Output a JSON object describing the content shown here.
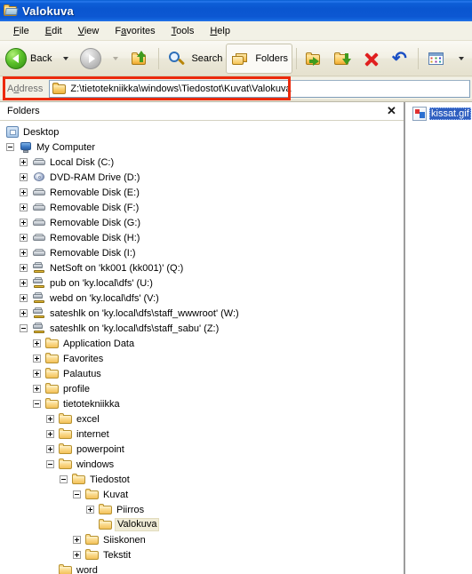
{
  "window": {
    "title": "Valokuva",
    "title_icon": "open-folder-icon"
  },
  "menubar": {
    "items": [
      {
        "label": "File",
        "accel": "F"
      },
      {
        "label": "Edit",
        "accel": "E"
      },
      {
        "label": "View",
        "accel": "V"
      },
      {
        "label": "Favorites",
        "accel": "a"
      },
      {
        "label": "Tools",
        "accel": "T"
      },
      {
        "label": "Help",
        "accel": "H"
      }
    ]
  },
  "toolbar": {
    "back_label": "Back",
    "search_label": "Search",
    "folders_label": "Folders",
    "buttons": [
      {
        "name": "back-button",
        "icon": "back-arrow-icon"
      },
      {
        "name": "back-dropdown",
        "icon": "chevron-down-icon"
      },
      {
        "name": "forward-button",
        "icon": "forward-arrow-icon"
      },
      {
        "name": "forward-dropdown",
        "icon": "chevron-down-icon"
      },
      {
        "name": "up-button",
        "icon": "up-folder-icon"
      },
      {
        "name": "search-button",
        "icon": "search-icon"
      },
      {
        "name": "folders-button",
        "icon": "folders-icon"
      },
      {
        "name": "move-to-button",
        "icon": "move-to-folder-icon"
      },
      {
        "name": "copy-to-button",
        "icon": "copy-to-folder-icon"
      },
      {
        "name": "delete-button",
        "icon": "delete-x-icon"
      },
      {
        "name": "undo-button",
        "icon": "undo-arrow-icon"
      },
      {
        "name": "views-button",
        "icon": "views-icon"
      },
      {
        "name": "views-dropdown",
        "icon": "chevron-down-icon"
      },
      {
        "name": "folder-sync-button",
        "icon": "folder-sync-icon"
      }
    ]
  },
  "address": {
    "label": "Address",
    "accel": "d",
    "path": "Z:\\tietotekniikka\\windows\\Tiedostot\\Kuvat\\Valokuva",
    "icon": "folder-icon",
    "highlight_color": "#ec2a0c"
  },
  "folders_pane": {
    "title": "Folders",
    "close_label": "✕"
  },
  "tree": [
    {
      "label": "Desktop",
      "depth": 0,
      "icon": "desktop-icon",
      "expander": "none",
      "selected": false
    },
    {
      "label": "My Computer",
      "depth": 1,
      "icon": "computer-icon",
      "expander": "minus",
      "selected": false
    },
    {
      "label": "Local Disk (C:)",
      "depth": 2,
      "icon": "drive-icon",
      "expander": "plus",
      "selected": false
    },
    {
      "label": "DVD-RAM Drive (D:)",
      "depth": 2,
      "icon": "dvd-drive-icon",
      "expander": "plus",
      "selected": false
    },
    {
      "label": "Removable Disk (E:)",
      "depth": 2,
      "icon": "drive-icon",
      "expander": "plus",
      "selected": false
    },
    {
      "label": "Removable Disk (F:)",
      "depth": 2,
      "icon": "drive-icon",
      "expander": "plus",
      "selected": false
    },
    {
      "label": "Removable Disk (G:)",
      "depth": 2,
      "icon": "drive-icon",
      "expander": "plus",
      "selected": false
    },
    {
      "label": "Removable Disk (H:)",
      "depth": 2,
      "icon": "drive-icon",
      "expander": "plus",
      "selected": false
    },
    {
      "label": "Removable Disk (I:)",
      "depth": 2,
      "icon": "drive-icon",
      "expander": "plus",
      "selected": false
    },
    {
      "label": "NetSoft on 'kk001 (kk001)' (Q:)",
      "depth": 2,
      "icon": "network-drive-icon",
      "expander": "plus",
      "selected": false
    },
    {
      "label": "pub on 'ky.local\\dfs' (U:)",
      "depth": 2,
      "icon": "network-drive-icon",
      "expander": "plus",
      "selected": false
    },
    {
      "label": "webd on 'ky.local\\dfs' (V:)",
      "depth": 2,
      "icon": "network-drive-icon",
      "expander": "plus",
      "selected": false
    },
    {
      "label": "sateshlk on 'ky.local\\dfs\\staff_wwwroot' (W:)",
      "depth": 2,
      "icon": "network-drive-icon",
      "expander": "plus",
      "selected": false
    },
    {
      "label": "sateshlk on 'ky.local\\dfs\\staff_sabu' (Z:)",
      "depth": 2,
      "icon": "network-drive-icon",
      "expander": "minus",
      "selected": false
    },
    {
      "label": "Application Data",
      "depth": 3,
      "icon": "folder-icon",
      "expander": "plus",
      "selected": false
    },
    {
      "label": "Favorites",
      "depth": 3,
      "icon": "folder-icon",
      "expander": "plus",
      "selected": false
    },
    {
      "label": "Palautus",
      "depth": 3,
      "icon": "folder-icon",
      "expander": "plus",
      "selected": false
    },
    {
      "label": "profile",
      "depth": 3,
      "icon": "folder-icon",
      "expander": "plus",
      "selected": false
    },
    {
      "label": "tietotekniikka",
      "depth": 3,
      "icon": "folder-icon",
      "expander": "minus",
      "selected": false
    },
    {
      "label": "excel",
      "depth": 4,
      "icon": "folder-icon",
      "expander": "plus",
      "selected": false
    },
    {
      "label": "internet",
      "depth": 4,
      "icon": "folder-icon",
      "expander": "plus",
      "selected": false
    },
    {
      "label": "powerpoint",
      "depth": 4,
      "icon": "folder-icon",
      "expander": "plus",
      "selected": false
    },
    {
      "label": "windows",
      "depth": 4,
      "icon": "folder-icon",
      "expander": "minus",
      "selected": false
    },
    {
      "label": "Tiedostot",
      "depth": 5,
      "icon": "folder-icon",
      "expander": "minus",
      "selected": false
    },
    {
      "label": "Kuvat",
      "depth": 6,
      "icon": "folder-icon",
      "expander": "minus",
      "selected": false
    },
    {
      "label": "Piirros",
      "depth": 7,
      "icon": "folder-icon",
      "expander": "plus",
      "selected": false
    },
    {
      "label": "Valokuva",
      "depth": 7,
      "icon": "folder-icon",
      "expander": "none",
      "selected": true
    },
    {
      "label": "Siiskonen",
      "depth": 6,
      "icon": "folder-icon",
      "expander": "plus",
      "selected": false
    },
    {
      "label": "Tekstit",
      "depth": 6,
      "icon": "folder-icon",
      "expander": "plus",
      "selected": false
    },
    {
      "label": "word",
      "depth": 4,
      "icon": "folder-icon",
      "expander": "none",
      "selected": false
    }
  ],
  "file_list": {
    "items": [
      {
        "name": "kissat.gif",
        "icon": "gif-image-icon",
        "selected": true
      }
    ]
  }
}
